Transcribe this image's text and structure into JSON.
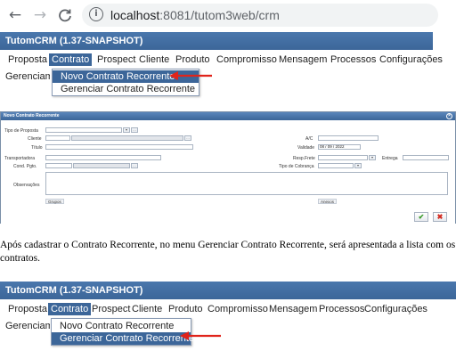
{
  "browser": {
    "back_icon": "←",
    "forward_icon": "→",
    "reload_icon": "C",
    "info_icon": "i",
    "url_host": "localhost",
    "url_path": ":8081/tutom3web/crm"
  },
  "app1": {
    "title": "TutomCRM (1.37-SNAPSHOT)",
    "menu": [
      "Proposta",
      "Contrato",
      "Prospect",
      "Cliente",
      "Produto",
      "Compromisso",
      "Mensagem",
      "Processos",
      "Configurações"
    ],
    "below_text": "Gerenciam",
    "dropdown": [
      "Novo Contrato Recorrente",
      "Gerenciar Contrato Recorrente"
    ],
    "selected_index": 0
  },
  "dialog": {
    "title": "Novo Contrato Recorrente",
    "close_icon": "×",
    "labels": {
      "tipo_proposta": "Tipo de Proposta",
      "cliente": "Cliente",
      "titulo": "Título",
      "transportadora": "Transportadora",
      "cond_pgto": "Cond. Pgto.",
      "observacoes": "Observações",
      "ac": "A/C",
      "validade": "Validade",
      "resp_frete": "Resp.Frete",
      "entrega": "Entrega",
      "tipo_cobranca": "Tipo de Cobrança"
    },
    "validade_value": "08 / 09 / 2022",
    "tabs": [
      "Grupos",
      "Anexos"
    ],
    "ok_icon": "✔",
    "cancel_icon": "✖"
  },
  "paragraph": "Após cadastrar o Contrato Recorrente, no menu Gerenciar Contrato Recorrente, será apresentada a lista com os contratos.",
  "app2": {
    "title": "TutomCRM (1.37-SNAPSHOT)",
    "menu": [
      "Proposta",
      "Contrato",
      "Prospect",
      "Cliente",
      "Produto",
      "Compromisso",
      "Mensagem",
      "Processos",
      "Configurações"
    ],
    "below_text": "Gerenciam",
    "dropdown": [
      "Novo Contrato Recorrente",
      "Gerenciar Contrato Recorrente"
    ],
    "selected_index": 1
  },
  "colors": {
    "header_blue": "#3c6699",
    "arrow_red": "#e0241b"
  }
}
